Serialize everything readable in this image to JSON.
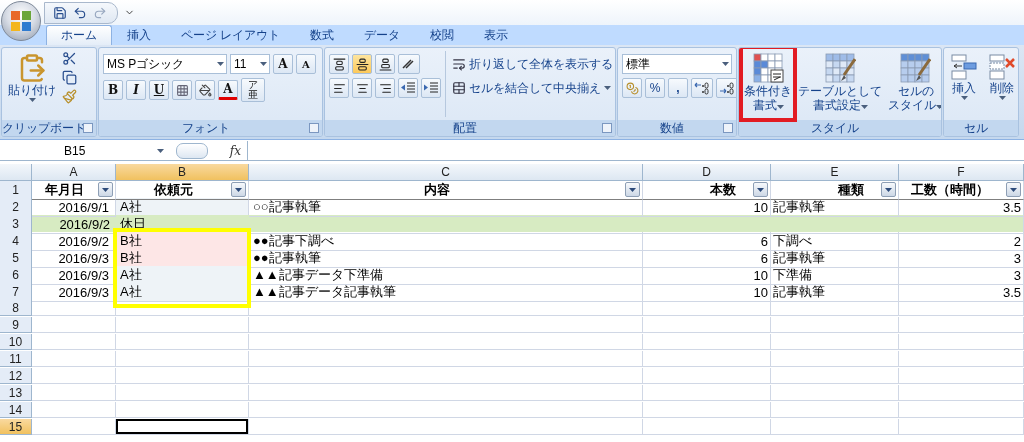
{
  "tabs": [
    {
      "label": "ホーム",
      "selected": true
    },
    {
      "label": "挿入",
      "selected": false
    },
    {
      "label": "ページ レイアウト",
      "selected": false
    },
    {
      "label": "数式",
      "selected": false
    },
    {
      "label": "データ",
      "selected": false
    },
    {
      "label": "校閲",
      "selected": false
    },
    {
      "label": "表示",
      "selected": false
    }
  ],
  "clipboard": {
    "label": "クリップボード",
    "paste": "貼り付け"
  },
  "font": {
    "label": "フォント",
    "name": "MS Pゴシック",
    "size": "11",
    "grow": "A",
    "shrink": "A",
    "bold": "B",
    "italic": "I",
    "underline": "U",
    "color_letter": "A",
    "phonetic": "亜",
    "phonetic_ruby": "ア"
  },
  "alignment": {
    "label": "配置",
    "vertical": [
      {
        "selected": false
      },
      {
        "selected": true
      },
      {
        "selected": false
      }
    ],
    "wrap": "折り返して全体を表示する",
    "merge": "セルを結合して中央揃え"
  },
  "number": {
    "label": "数値",
    "format": "標準",
    "percent": "%",
    "comma": ","
  },
  "styles": {
    "label": "スタイル",
    "buttons": [
      {
        "kind": "conditional",
        "lines": [
          "条件付き",
          "書式"
        ]
      },
      {
        "kind": "table",
        "lines": [
          "テーブルとして",
          "書式設定"
        ]
      },
      {
        "kind": "cell",
        "lines": [
          "セルの",
          "スタイル"
        ]
      }
    ]
  },
  "cells": {
    "label": "セル",
    "buttons": [
      {
        "kind": "insert",
        "label": "挿入"
      },
      {
        "kind": "delete",
        "label": "削除"
      }
    ]
  },
  "formula_bar": {
    "name_box": "B15",
    "fx": "fx"
  },
  "columns": [
    {
      "letter": "A",
      "selected": false
    },
    {
      "letter": "B",
      "selected": true
    },
    {
      "letter": "C",
      "selected": false
    },
    {
      "letter": "D",
      "selected": false
    },
    {
      "letter": "E",
      "selected": false
    },
    {
      "letter": "F",
      "selected": false
    }
  ],
  "header": {
    "number": "1",
    "cells": [
      "年月日",
      "依頼元",
      "内容",
      "本数",
      "種類",
      "工数（時間）"
    ]
  },
  "rows": [
    {
      "number": "2",
      "highlighted": false,
      "date": "2016/9/1",
      "client": {
        "text": "A社",
        "color": "#eef3f7"
      },
      "content": "○○記事執筆",
      "count": "10",
      "type": "記事執筆",
      "hours": "3.5"
    },
    {
      "number": "3",
      "highlighted": true,
      "date": "2016/9/2",
      "client": {
        "text": "休日",
        "color": "#d7ebc2"
      }
    },
    {
      "number": "4",
      "highlighted": false,
      "date": "2016/9/2",
      "client": {
        "text": "B社",
        "color": "#fde6e6"
      },
      "content": "●●記事下調べ",
      "count": "6",
      "type": "下調べ",
      "hours": "2"
    },
    {
      "number": "5",
      "highlighted": false,
      "date": "2016/9/3",
      "client": {
        "text": "B社",
        "color": "#fde6e6"
      },
      "content": "●●記事執筆",
      "count": "6",
      "type": "記事執筆",
      "hours": "3"
    },
    {
      "number": "6",
      "highlighted": false,
      "date": "2016/9/3",
      "client": {
        "text": "A社",
        "color": "#eef3f7"
      },
      "content": "▲▲記事データ下準備",
      "count": "10",
      "type": "下準備",
      "hours": "3"
    },
    {
      "number": "7",
      "highlighted": false,
      "date": "2016/9/3",
      "client": {
        "text": "A社",
        "color": "#eef3f7"
      },
      "content": "▲▲記事データ記事執筆",
      "count": "10",
      "type": "記事執筆",
      "hours": "3.5"
    }
  ],
  "empty_rows": [
    {
      "number": "8",
      "selected": false
    },
    {
      "number": "9",
      "selected": false
    },
    {
      "number": "10",
      "selected": false
    },
    {
      "number": "11",
      "selected": false
    },
    {
      "number": "12",
      "selected": false
    },
    {
      "number": "13",
      "selected": false
    },
    {
      "number": "14",
      "selected": false
    },
    {
      "number": "15",
      "selected": true
    }
  ]
}
